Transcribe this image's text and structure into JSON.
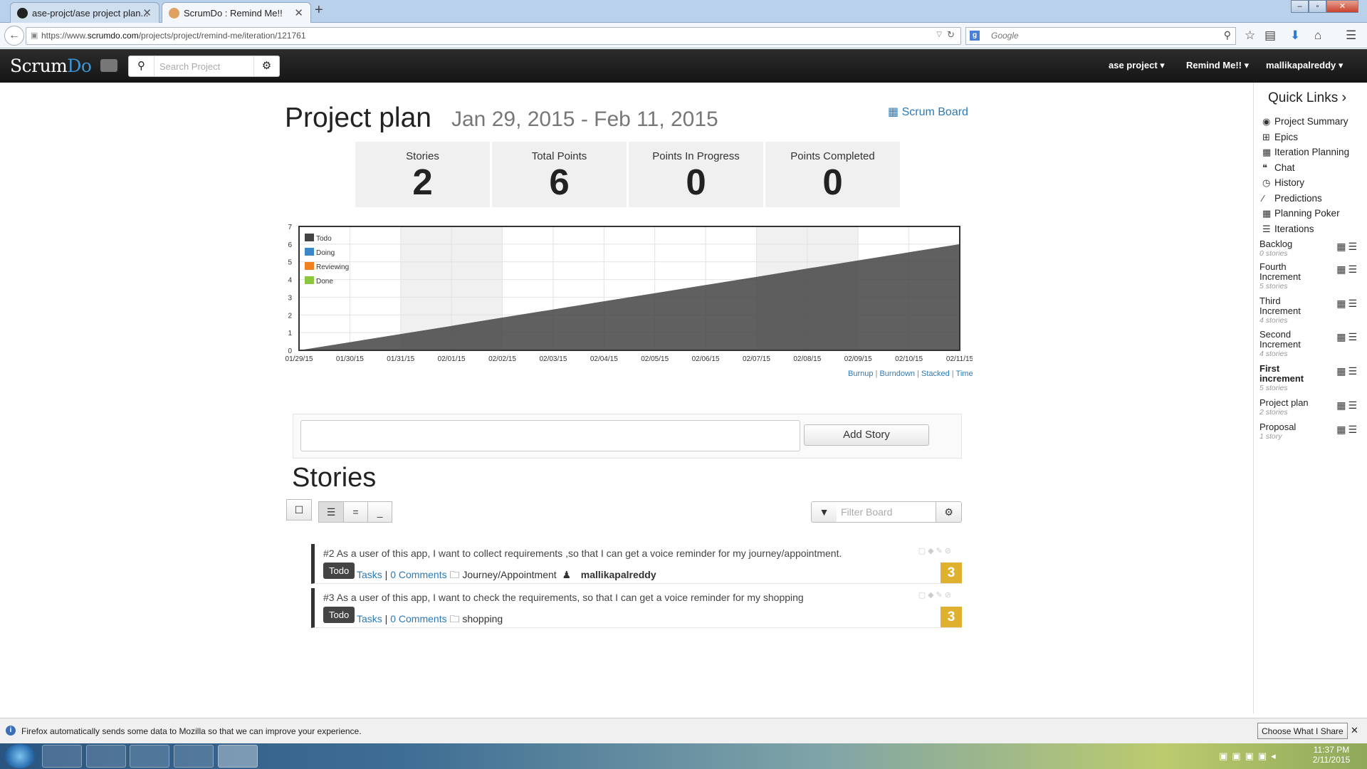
{
  "browser": {
    "tabs": [
      {
        "label": "ase-projct/ase project plan..."
      },
      {
        "label": "ScrumDo : Remind Me!!"
      }
    ],
    "url_prefix": "https://www.",
    "url_domain": "scrumdo.com",
    "url_path": "/projects/project/remind-me/iteration/121761",
    "search_placeholder": "Google",
    "notification": "Firefox automatically sends some data to Mozilla so that we can improve your experience.",
    "notification_button": "Choose What I Share"
  },
  "app": {
    "logo_a": "Scrum",
    "logo_b": "Do",
    "search_placeholder": "Search Project",
    "menus": [
      {
        "label": "ase project"
      },
      {
        "label": "Remind Me!!"
      },
      {
        "label": "mallikapalreddy"
      }
    ]
  },
  "page": {
    "title": "Project plan",
    "date_range": "Jan 29, 2015 - Feb 11, 2015",
    "scrum_board_label": "Scrum Board",
    "stats": [
      {
        "label": "Stories",
        "value": "2"
      },
      {
        "label": "Total Points",
        "value": "6"
      },
      {
        "label": "Points In Progress",
        "value": "0"
      },
      {
        "label": "Points Completed",
        "value": "0"
      }
    ],
    "chart_links": [
      "Burnup",
      "Burndown",
      "Stacked",
      "Time"
    ],
    "add_story_label": "Add Story",
    "stories_heading": "Stories",
    "filter_placeholder": "Filter Board"
  },
  "chart_data": {
    "type": "area",
    "x": [
      "01/29/15",
      "01/30/15",
      "01/31/15",
      "02/01/15",
      "02/02/15",
      "02/03/15",
      "02/04/15",
      "02/05/15",
      "02/06/15",
      "02/07/15",
      "02/08/15",
      "02/09/15",
      "02/10/15",
      "02/11/15"
    ],
    "ylim": [
      0,
      7
    ],
    "yticks": [
      0,
      1,
      2,
      3,
      4,
      5,
      6,
      7
    ],
    "legend_position": "top-left",
    "grid": true,
    "series": [
      {
        "name": "Todo",
        "color": "#444444",
        "values": [
          0,
          0.46,
          0.92,
          1.38,
          1.85,
          2.31,
          2.77,
          3.23,
          3.69,
          4.15,
          4.62,
          5.08,
          5.54,
          6
        ]
      },
      {
        "name": "Doing",
        "color": "#3b87c8",
        "values": [
          0,
          0,
          0,
          0,
          0,
          0,
          0,
          0,
          0,
          0,
          0,
          0,
          0,
          0
        ]
      },
      {
        "name": "Reviewing",
        "color": "#f08020",
        "values": [
          0,
          0,
          0,
          0,
          0,
          0,
          0,
          0,
          0,
          0,
          0,
          0,
          0,
          0
        ]
      },
      {
        "name": "Done",
        "color": "#8cc63f",
        "values": [
          0,
          0,
          0,
          0,
          0,
          0,
          0,
          0,
          0,
          0,
          0,
          0,
          0,
          0
        ]
      }
    ]
  },
  "stories": [
    {
      "text": "#2 As a user of this app, I want to collect requirements ,so that I can get a voice reminder for my journey/appointment.",
      "status": "Todo",
      "tasks_label": "Tasks",
      "comments_label": "0 Comments",
      "epic": "Journey/Appointment",
      "assignee": "mallikapalreddy",
      "points": "3"
    },
    {
      "text": "#3 As a user of this app, I want to check the requirements, so that I can get a voice reminder for my shopping",
      "status": "Todo",
      "tasks_label": "Tasks",
      "comments_label": "0 Comments",
      "epic": "shopping",
      "assignee": "",
      "points": "3"
    }
  ],
  "sidebar": {
    "title": "Quick Links",
    "links": [
      {
        "label": "Project Summary",
        "icon": "globe-icon"
      },
      {
        "label": "Epics",
        "icon": "sitemap-icon"
      },
      {
        "label": "Iteration Planning",
        "icon": "calendar-icon"
      },
      {
        "label": "Chat",
        "icon": "quote-icon"
      },
      {
        "label": "History",
        "icon": "clock-icon"
      },
      {
        "label": "Predictions",
        "icon": "wand-icon"
      },
      {
        "label": "Planning Poker",
        "icon": "grid-icon"
      },
      {
        "label": "Iterations",
        "icon": "list-icon"
      }
    ],
    "iterations": [
      {
        "name": "Backlog",
        "count": "0 stories"
      },
      {
        "name": "Fourth Increment",
        "count": "5 stories"
      },
      {
        "name": "Third Increment",
        "count": "4 stories"
      },
      {
        "name": "Second Increment",
        "count": "4 stories"
      },
      {
        "name": "First increment",
        "count": "5 stories"
      },
      {
        "name": "Project plan",
        "count": "2 stories"
      },
      {
        "name": "Proposal",
        "count": "1 story"
      }
    ]
  },
  "taskbar": {
    "time": "11:37 PM",
    "date": "2/11/2015"
  }
}
